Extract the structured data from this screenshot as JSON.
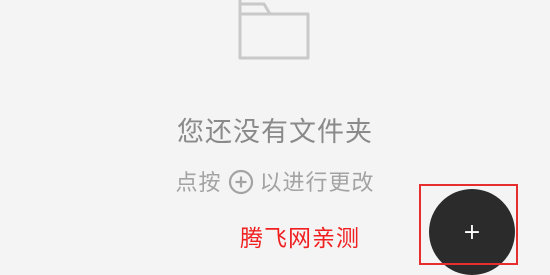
{
  "empty_state": {
    "icon": "folder-icon",
    "title": "您还没有文件夹",
    "hint_before": "点按",
    "hint_icon": "plus-circle-icon",
    "hint_after": "以进行更改"
  },
  "fab": {
    "label": "+",
    "icon": "plus-icon"
  },
  "watermark": {
    "text": "腾飞网亲测"
  },
  "colors": {
    "background": "#f4f4f4",
    "title_text": "#8a8a8a",
    "hint_text": "#a3a3a3",
    "fab_background": "#2b2b2b",
    "watermark": "#f02020",
    "highlight": "#e62e2e"
  }
}
